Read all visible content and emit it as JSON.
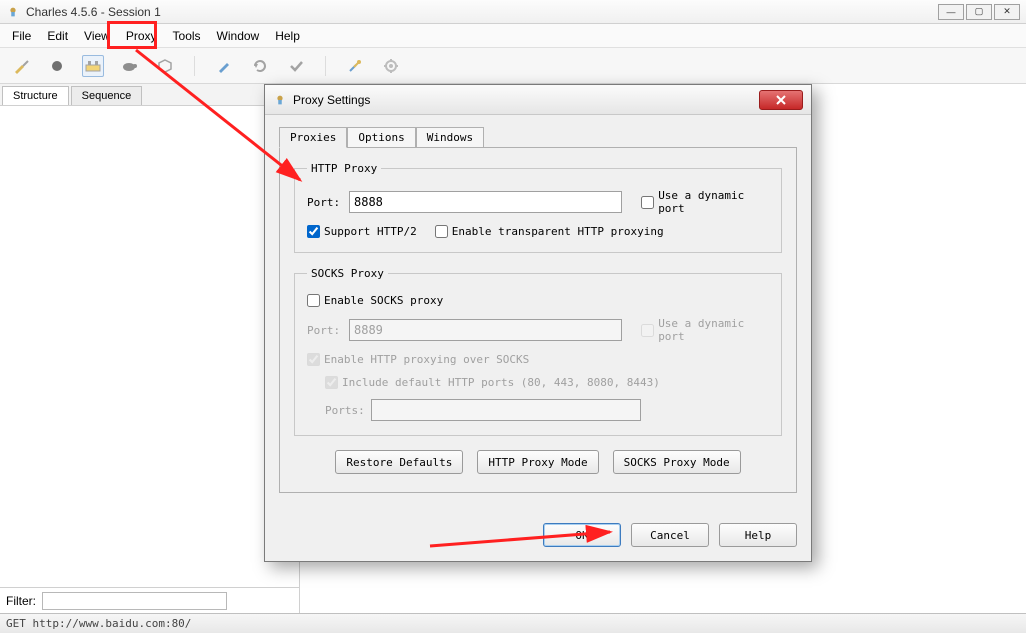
{
  "title": "Charles 4.5.6 - Session 1",
  "menu": [
    "File",
    "Edit",
    "View",
    "Proxy",
    "Tools",
    "Window",
    "Help"
  ],
  "sidebar": {
    "tabs": [
      "Structure",
      "Sequence"
    ],
    "filter_label": "Filter:"
  },
  "status": "GET http://www.baidu.com:80/",
  "dialog": {
    "title": "Proxy Settings",
    "tabs": [
      "Proxies",
      "Options",
      "Windows"
    ],
    "http": {
      "legend": "HTTP Proxy",
      "port_label": "Port:",
      "port_value": "8888",
      "dynamic_label": "Use a dynamic port",
      "support_label": "Support HTTP/2",
      "transparent_label": "Enable transparent HTTP proxying"
    },
    "socks": {
      "legend": "SOCKS Proxy",
      "enable_label": "Enable SOCKS proxy",
      "port_label": "Port:",
      "port_value": "8889",
      "dynamic_label": "Use a dynamic port",
      "overSocks_label": "Enable HTTP proxying over SOCKS",
      "include_label": "Include default HTTP ports (80, 443, 8080, 8443)",
      "ports_label": "Ports:"
    },
    "buttons": {
      "restore": "Restore Defaults",
      "http_mode": "HTTP Proxy Mode",
      "socks_mode": "SOCKS Proxy Mode",
      "ok": "OK",
      "cancel": "Cancel",
      "help": "Help"
    }
  }
}
